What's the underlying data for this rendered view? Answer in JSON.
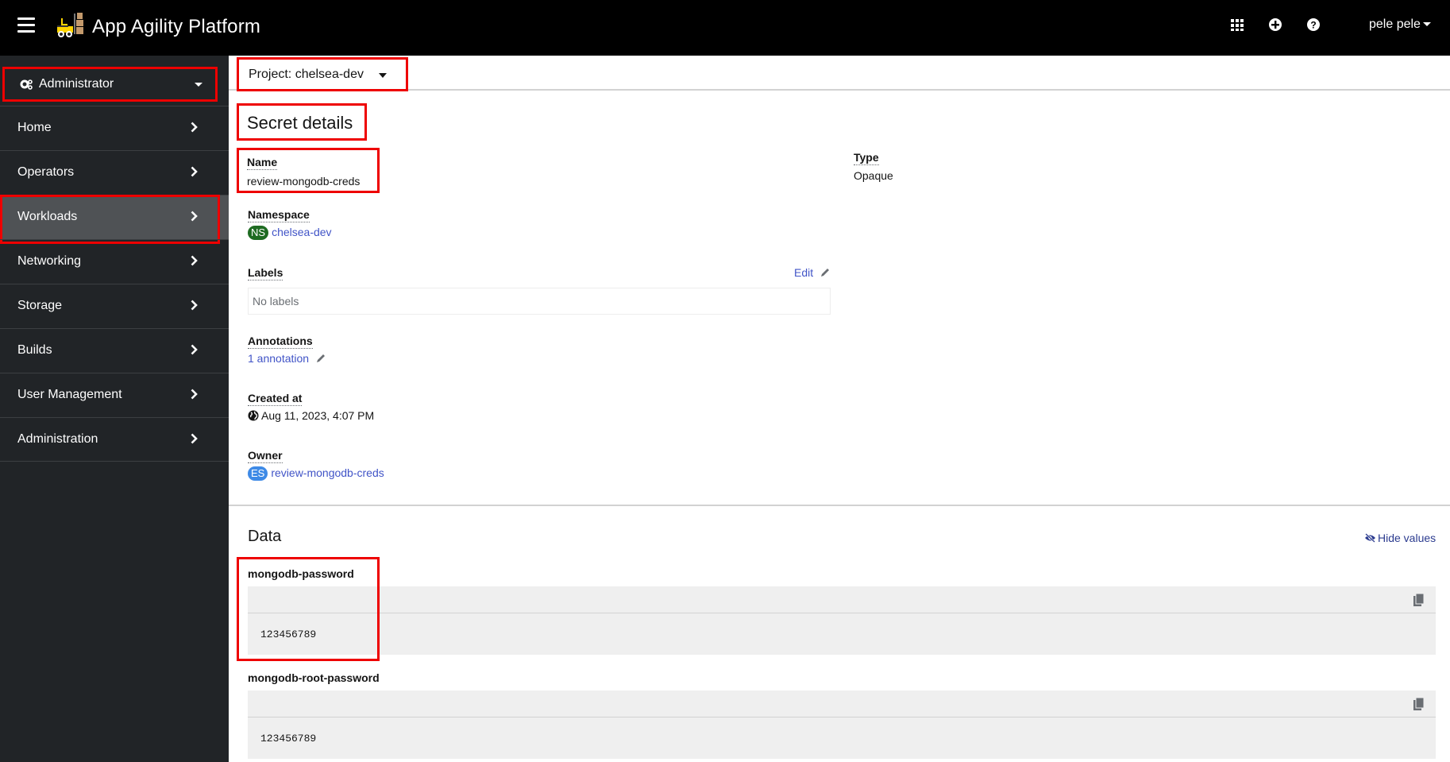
{
  "header": {
    "app_title": "App Agility Platform",
    "icons": [
      "menu-icon",
      "app-launcher-icon",
      "add-icon",
      "help-icon"
    ],
    "user_name": "pele pele"
  },
  "sidebar": {
    "perspective": "Administrator",
    "items": [
      {
        "label": "Home"
      },
      {
        "label": "Operators"
      },
      {
        "label": "Workloads",
        "active": true
      },
      {
        "label": "Networking"
      },
      {
        "label": "Storage"
      },
      {
        "label": "Builds"
      },
      {
        "label": "User Management"
      },
      {
        "label": "Administration"
      }
    ]
  },
  "project_selector": {
    "label": "Project: chelsea-dev"
  },
  "page": {
    "title": "Secret details",
    "name_label": "Name",
    "name_value": "review-mongodb-creds",
    "type_label": "Type",
    "type_value": "Opaque",
    "namespace_label": "Namespace",
    "namespace_badge": "NS",
    "namespace_value": "chelsea-dev",
    "labels_label": "Labels",
    "labels_edit": "Edit",
    "labels_empty": "No labels",
    "annotations_label": "Annotations",
    "annotations_value": "1 annotation",
    "created_label": "Created at",
    "created_value": "Aug 11, 2023, 4:07 PM",
    "owner_label": "Owner",
    "owner_badge": "ES",
    "owner_value": "review-mongodb-creds"
  },
  "data_section": {
    "title": "Data",
    "hide_values": "Hide values",
    "secrets": [
      {
        "key": "mongodb-password",
        "value": "123456789"
      },
      {
        "key": "mongodb-root-password",
        "value": "123456789"
      }
    ]
  }
}
